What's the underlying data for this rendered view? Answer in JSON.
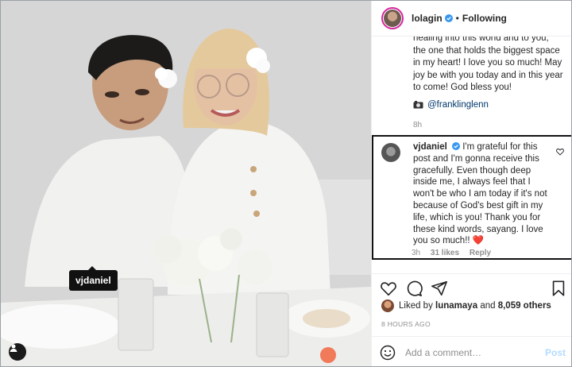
{
  "photo": {
    "tag_label": "vjdaniel"
  },
  "header": {
    "username": "lolagin",
    "separator": "•",
    "follow_status": "Following"
  },
  "caption": {
    "lines": [
      "healing into this world and to you,",
      "the one that holds the biggest space",
      "in my heart! I love you so much! May",
      "joy be with you today and in this year",
      "to come! God bless you!"
    ],
    "mention": "@franklinglenn",
    "time": "8h"
  },
  "comment": {
    "username": "vjdaniel",
    "text": "I'm grateful for this post and I'm gonna receive this gracefully. Even though deep inside me, I always feel that I won't be who I am today if it's not because of God's best gift in my life, which is you! Thank you for these kind words, sayang. I love you so much!!",
    "heart_emoji": "❤️",
    "time": "3h",
    "likes": "31 likes",
    "reply": "Reply"
  },
  "likes": {
    "prefix": "Liked by",
    "user": "lunamaya",
    "connector": "and",
    "others": "8,059 others"
  },
  "post_time": "8 HOURS AGO",
  "add_comment": {
    "placeholder": "Add a comment…",
    "post_label": "Post"
  },
  "colors": {
    "verified": "#3897f0",
    "link": "#00376b",
    "heart": "#ed4956",
    "post_disabled": "#b3dbff"
  }
}
